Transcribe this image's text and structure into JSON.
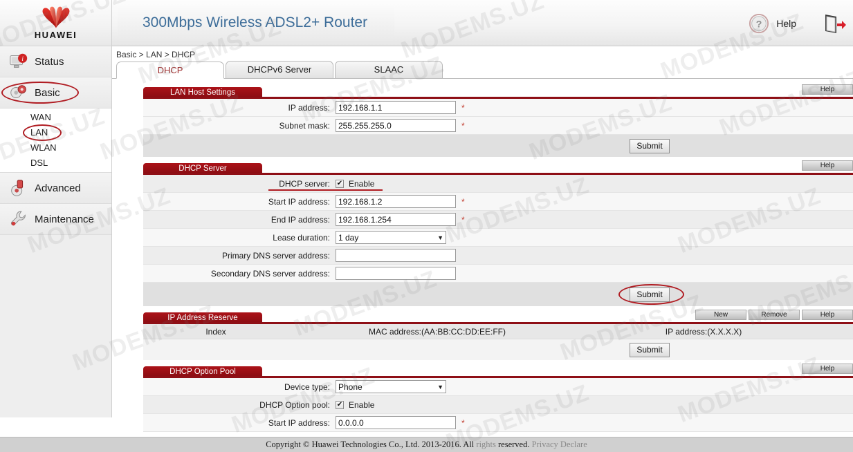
{
  "brand": {
    "logo_text": "HUAWEI"
  },
  "header": {
    "title": "300Mbps Wireless ADSL2+ Router",
    "help_label": "Help",
    "help_icon": "question-circle-icon",
    "logout_icon": "logout-door-icon"
  },
  "breadcrumb": "Basic > LAN > DHCP",
  "tabs": [
    {
      "label": "DHCP",
      "active": true
    },
    {
      "label": "DHCPv6 Server",
      "active": false
    },
    {
      "label": "SLAAC",
      "active": false
    }
  ],
  "sidebar": {
    "items": [
      {
        "label": "Status",
        "icon": "monitor-info-icon",
        "type": "main"
      },
      {
        "label": "Basic",
        "icon": "gears-icon",
        "type": "main",
        "selected": true,
        "annotated": true
      },
      {
        "label": "WAN",
        "type": "sub"
      },
      {
        "label": "LAN",
        "type": "sub",
        "selected": true,
        "annotated": true
      },
      {
        "label": "WLAN",
        "type": "sub"
      },
      {
        "label": "DSL",
        "type": "sub"
      },
      {
        "label": "Advanced",
        "icon": "wrench-gear-icon",
        "type": "main"
      },
      {
        "label": "Maintenance",
        "icon": "wrench-icon",
        "type": "main"
      }
    ]
  },
  "sections": {
    "lan_host": {
      "title": "LAN Host Settings",
      "help_label": "Help",
      "fields": [
        {
          "label": "IP address:",
          "value": "192.168.1.1",
          "required": "*"
        },
        {
          "label": "Subnet mask:",
          "value": "255.255.255.0",
          "required": "*"
        }
      ],
      "submit_label": "Submit"
    },
    "dhcp_server": {
      "title": "DHCP Server",
      "help_label": "Help",
      "enable_row": {
        "label": "DHCP server:",
        "checkbox_checked": true,
        "enable_label": "Enable"
      },
      "fields": [
        {
          "label": "Start IP address:",
          "value": "192.168.1.2",
          "required": "*"
        },
        {
          "label": "End IP address:",
          "value": "192.168.1.254",
          "required": "*"
        }
      ],
      "lease": {
        "label": "Lease duration:",
        "value": "1 day"
      },
      "dns": [
        {
          "label": "Primary DNS server address:",
          "value": ""
        },
        {
          "label": "Secondary DNS server address:",
          "value": ""
        }
      ],
      "submit_label": "Submit"
    },
    "ip_reserve": {
      "title": "IP Address Reserve",
      "buttons": [
        "New",
        "Remove",
        "Help"
      ],
      "columns": [
        "Index",
        "MAC address:(AA:BB:CC:DD:EE:FF)",
        "IP address:(X.X.X.X)"
      ],
      "submit_label": "Submit"
    },
    "option_pool": {
      "title": "DHCP Option Pool",
      "help_label": "Help",
      "device_type": {
        "label": "Device type:",
        "value": "Phone"
      },
      "enable_row": {
        "label": "DHCP Option pool:",
        "checkbox_checked": true,
        "enable_label": "Enable"
      },
      "start_ip": {
        "label": "Start IP address:",
        "value": "0.0.0.0",
        "required": "*"
      }
    }
  },
  "footer": {
    "copyright_main": "Copyright © Huawei Technologies Co., Ltd. 2013-2016. All ",
    "copyright_faded": "rights",
    "copyright_main2": " reserved. ",
    "privacy": "Privacy Declare"
  },
  "watermark": {
    "text": "MODEMS.UZ"
  },
  "colors": {
    "brand_red": "#a2121a",
    "title_blue": "#3d6d99",
    "annotation_red": "#b01c22",
    "required_star": "#c0392b"
  }
}
